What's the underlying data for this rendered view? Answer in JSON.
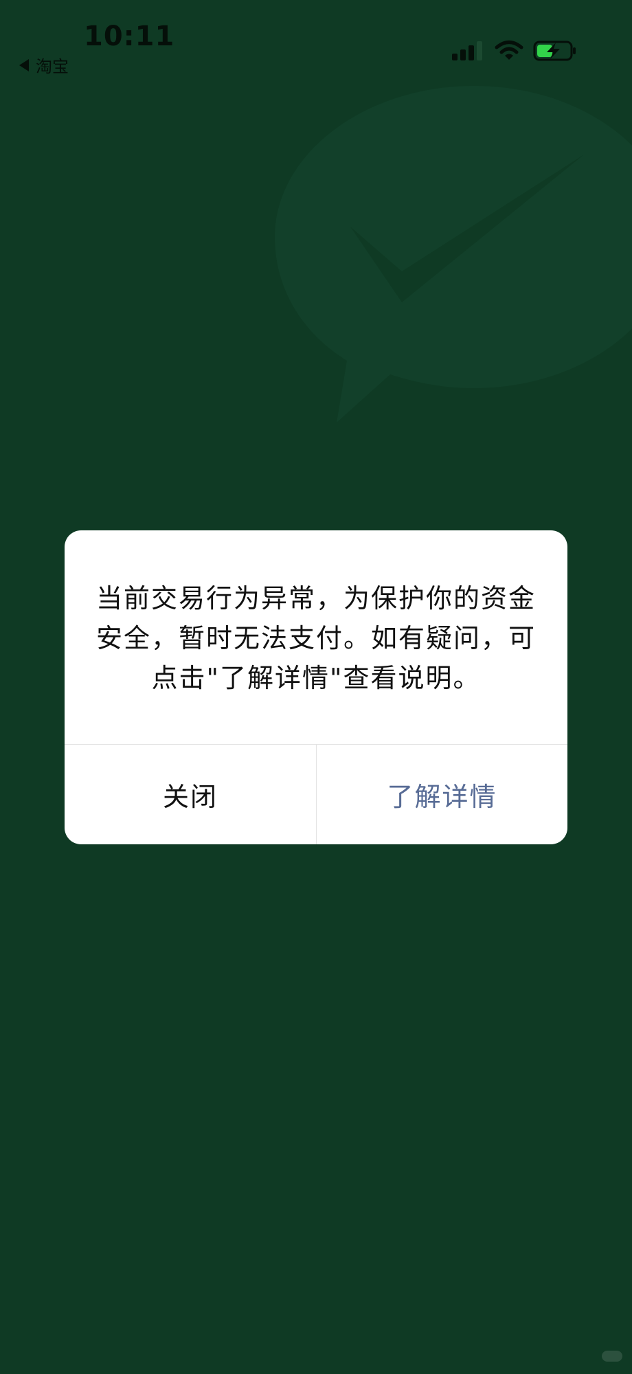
{
  "status_bar": {
    "time": "10:11",
    "back_app": "淘宝",
    "icons": [
      "signal-icon",
      "wifi-icon",
      "battery-charging-icon"
    ]
  },
  "background": {
    "logo": "wechat-pay-logo",
    "color": "#0f3a24"
  },
  "dialog": {
    "message": "当前交易行为异常，为保护你的资金安全，暂时无法支付。如有疑问，可点击\"了解详情\"查看说明。",
    "close_label": "关闭",
    "details_label": "了解详情",
    "details_color": "#576b95"
  }
}
